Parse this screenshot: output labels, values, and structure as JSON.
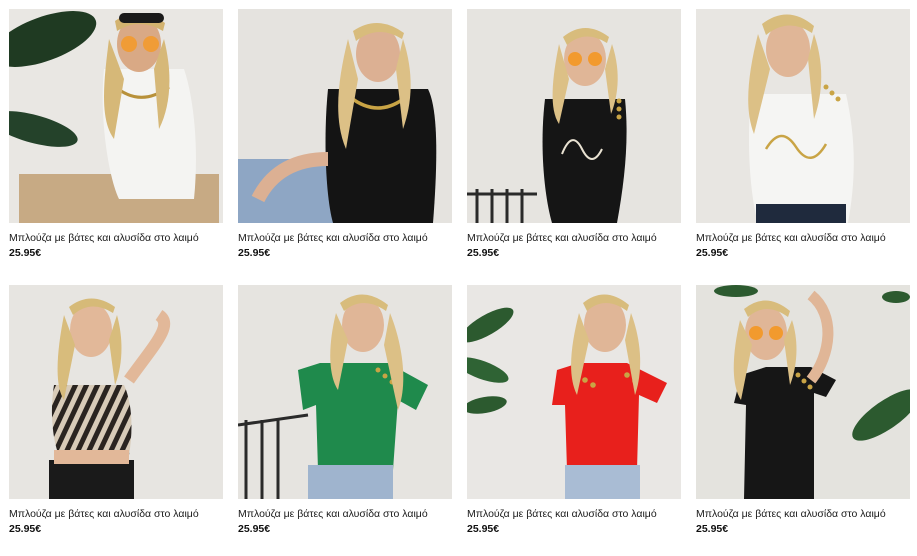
{
  "products": [
    {
      "name": "Μπλούζα με βάτες και αλυσίδα στο λαιμό",
      "price": "25.95€",
      "image": "model-white-top-chain-sunglasses",
      "shirt_color": "#f4f4f2",
      "bg_color": "#e9e7e3"
    },
    {
      "name": "Μπλούζα με βάτες και αλυσίδα στο λαιμό",
      "price": "25.95€",
      "image": "model-black-top-chain",
      "shirt_color": "#141414",
      "bg_color": "#e5e3df"
    },
    {
      "name": "Μπλούζα με βάτες και αλυσίδα στο λαιμό",
      "price": "25.95€",
      "image": "model-black-top-voyage-print",
      "shirt_color": "#151515",
      "bg_color": "#e6e4e0"
    },
    {
      "name": "Μπλούζα με βάτες και αλυσίδα στο λαιμό",
      "price": "25.95€",
      "image": "model-white-top-voyage-print",
      "shirt_color": "#f5f5f3",
      "bg_color": "#e8e6e2"
    },
    {
      "name": "Μπλούζα με βάτες και αλυσίδα στο λαιμό",
      "price": "25.95€",
      "image": "model-zebra-crop-top",
      "shirt_color": "#5a4a3c",
      "bg_color": "#e7e5e1"
    },
    {
      "name": "Μπλούζα με βάτες και αλυσίδα στο λαιμό",
      "price": "25.95€",
      "image": "model-green-tee-buttons",
      "shirt_color": "#1f8a4c",
      "bg_color": "#e6e4e0"
    },
    {
      "name": "Μπλούζα με βάτες και αλυσίδα στο λαιμό",
      "price": "25.95€",
      "image": "model-red-tee-buttons",
      "shirt_color": "#e8201c",
      "bg_color": "#e9e7e4"
    },
    {
      "name": "Μπλούζα με βάτες και αλυσίδα στο λαιμό",
      "price": "25.95€",
      "image": "model-black-tee-buttons",
      "shirt_color": "#161616",
      "bg_color": "#e4e3de"
    }
  ]
}
